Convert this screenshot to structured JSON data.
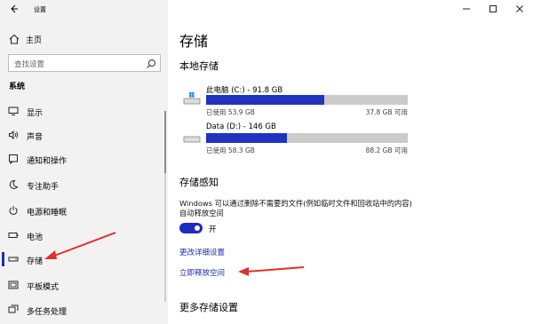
{
  "window": {
    "title": "设置"
  },
  "sidebar": {
    "home_label": "主页",
    "search_placeholder": "查找设置",
    "section_label": "系统",
    "items": [
      {
        "label": "显示",
        "icon": "monitor-icon"
      },
      {
        "label": "声音",
        "icon": "speaker-icon"
      },
      {
        "label": "通知和操作",
        "icon": "notification-icon"
      },
      {
        "label": "专注助手",
        "icon": "moon-icon"
      },
      {
        "label": "电源和睡眠",
        "icon": "power-icon"
      },
      {
        "label": "电池",
        "icon": "battery-icon"
      },
      {
        "label": "存储",
        "icon": "storage-icon",
        "active": true
      },
      {
        "label": "平板模式",
        "icon": "tablet-icon"
      },
      {
        "label": "多任务处理",
        "icon": "multitask-icon"
      }
    ]
  },
  "main": {
    "title": "存储",
    "local_storage_title": "本地存储",
    "drives": [
      {
        "name": "此电脑 (C:) - 91.8 GB",
        "used": "已使用 53.9 GB",
        "free": "37.8 GB 可用",
        "used_fraction": 0.587
      },
      {
        "name": "Data (D:) - 146 GB",
        "used": "已使用 58.3 GB",
        "free": "88.2 GB 可用",
        "used_fraction": 0.4
      }
    ],
    "storage_sense_title": "存储感知",
    "storage_sense_desc": "Windows 可以通过删除不需要的文件(例如临时文件和回收站中的内容)自动释放空间",
    "toggle_label": "开",
    "toggle_on": true,
    "change_link": "更改详细设置",
    "free_now_link": "立即释放空间",
    "more_title": "更多存储设置"
  },
  "colors": {
    "accent": "#1e2bc1",
    "annotation": "#e0302a"
  }
}
